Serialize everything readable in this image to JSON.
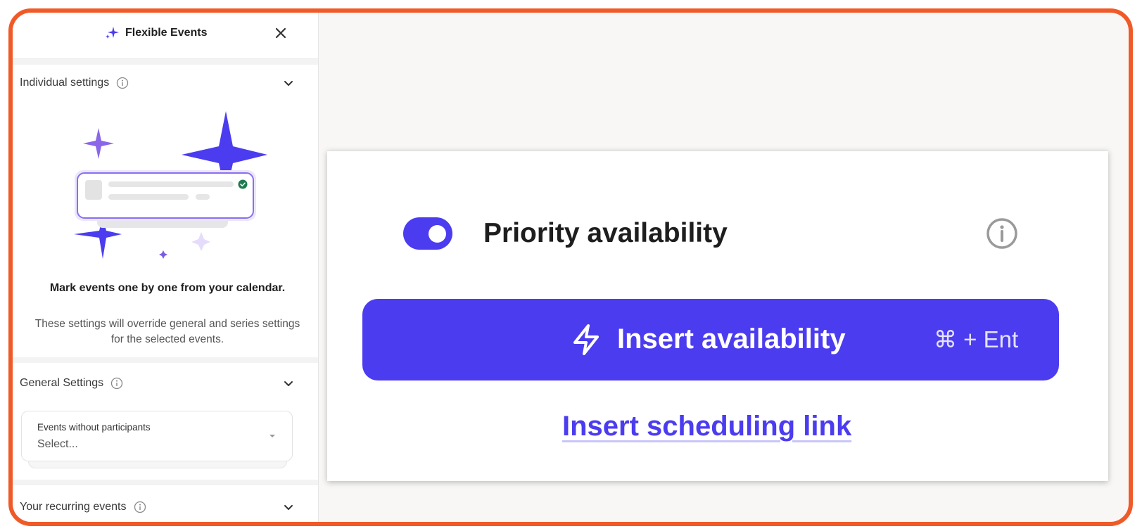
{
  "sidebar": {
    "title": "Flexible Events",
    "sections": {
      "individual": {
        "label": "Individual settings"
      },
      "general": {
        "label": "General Settings"
      },
      "recurring": {
        "label": "Your recurring events"
      }
    },
    "empty_state": {
      "title": "Mark events one by one from your calendar.",
      "description": "These settings will override general and series settings for the selected events."
    },
    "events_select": {
      "label": "Events without participants",
      "value": "Select..."
    }
  },
  "main": {
    "priority_label": "Priority availability",
    "priority_enabled": true,
    "insert_button_label": "Insert availability",
    "insert_shortcut": "⌘ + Ent",
    "scheduling_link_label": "Insert scheduling link"
  },
  "colors": {
    "accent": "#4b3cf0",
    "frame": "#f05a28",
    "check": "#1e7a4f"
  }
}
